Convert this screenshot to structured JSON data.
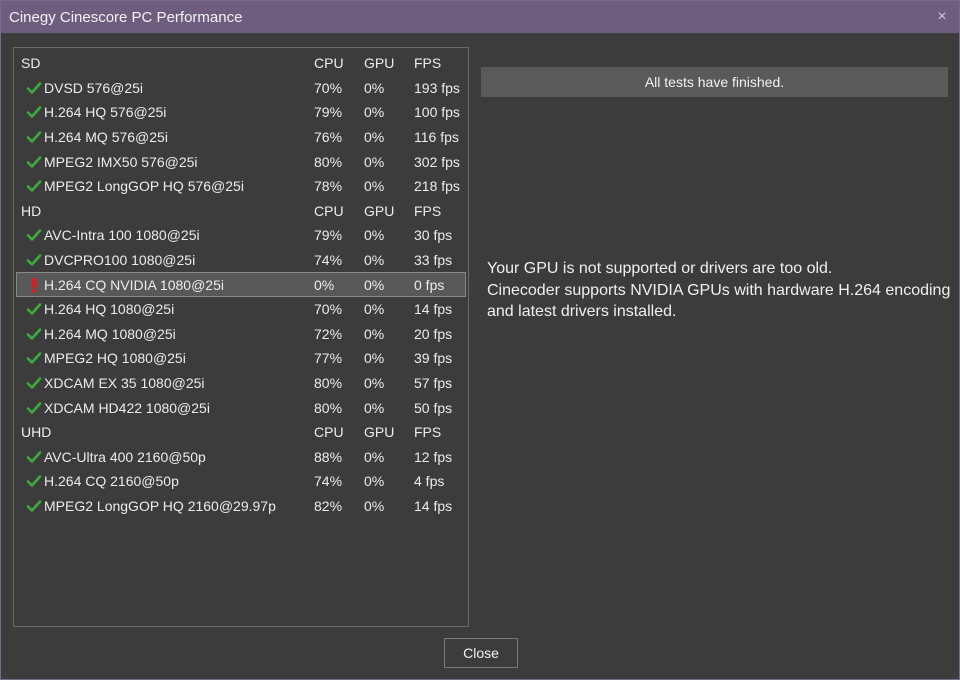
{
  "window": {
    "title": "Cinegy Cinescore PC Performance",
    "close_glyph": "×"
  },
  "colors": {
    "check": "#3dac3d",
    "warning": "#d42020",
    "titlebar": "#6f5d80"
  },
  "columns": {
    "cpu": "CPU",
    "gpu": "GPU",
    "fps": "FPS"
  },
  "sections": [
    {
      "name": "SD",
      "rows": [
        {
          "status": "check-icon",
          "name": "DVSD 576@25i",
          "cpu": "70%",
          "gpu": "0%",
          "fps": "193 fps"
        },
        {
          "status": "check-icon",
          "name": "H.264 HQ 576@25i",
          "cpu": "79%",
          "gpu": "0%",
          "fps": "100 fps"
        },
        {
          "status": "check-icon",
          "name": "H.264 MQ 576@25i",
          "cpu": "76%",
          "gpu": "0%",
          "fps": "116 fps"
        },
        {
          "status": "check-icon",
          "name": "MPEG2 IMX50 576@25i",
          "cpu": "80%",
          "gpu": "0%",
          "fps": "302 fps"
        },
        {
          "status": "check-icon",
          "name": "MPEG2 LongGOP HQ 576@25i",
          "cpu": "78%",
          "gpu": "0%",
          "fps": "218 fps"
        }
      ]
    },
    {
      "name": "HD",
      "rows": [
        {
          "status": "check-icon",
          "name": "AVC-Intra 100 1080@25i",
          "cpu": "79%",
          "gpu": "0%",
          "fps": "30 fps"
        },
        {
          "status": "check-icon",
          "name": "DVCPRO100 1080@25i",
          "cpu": "74%",
          "gpu": "0%",
          "fps": "33 fps"
        },
        {
          "status": "warning-icon",
          "name": "H.264 CQ NVIDIA 1080@25i",
          "cpu": "0%",
          "gpu": "0%",
          "fps": "0 fps",
          "selected": true
        },
        {
          "status": "check-icon",
          "name": "H.264 HQ 1080@25i",
          "cpu": "70%",
          "gpu": "0%",
          "fps": "14 fps"
        },
        {
          "status": "check-icon",
          "name": "H.264 MQ 1080@25i",
          "cpu": "72%",
          "gpu": "0%",
          "fps": "20 fps"
        },
        {
          "status": "check-icon",
          "name": "MPEG2 HQ 1080@25i",
          "cpu": "77%",
          "gpu": "0%",
          "fps": "39 fps"
        },
        {
          "status": "check-icon",
          "name": "XDCAM EX 35 1080@25i",
          "cpu": "80%",
          "gpu": "0%",
          "fps": "57 fps"
        },
        {
          "status": "check-icon",
          "name": "XDCAM HD422 1080@25i",
          "cpu": "80%",
          "gpu": "0%",
          "fps": "50 fps"
        }
      ]
    },
    {
      "name": "UHD",
      "rows": [
        {
          "status": "check-icon",
          "name": "AVC-Ultra 400 2160@50p",
          "cpu": "88%",
          "gpu": "0%",
          "fps": "12 fps"
        },
        {
          "status": "check-icon",
          "name": "H.264 CQ 2160@50p",
          "cpu": "74%",
          "gpu": "0%",
          "fps": "4 fps"
        },
        {
          "status": "check-icon",
          "name": "MPEG2 LongGOP HQ 2160@29.97p",
          "cpu": "82%",
          "gpu": "0%",
          "fps": "14 fps"
        }
      ]
    }
  ],
  "status_message": "All tests have finished.",
  "detail_message": [
    "Your GPU is not supported or drivers are too old.",
    "Cinecoder supports NVIDIA GPUs with hardware H.264 encoding",
    "and latest drivers installed."
  ],
  "close_button_label": "Close"
}
